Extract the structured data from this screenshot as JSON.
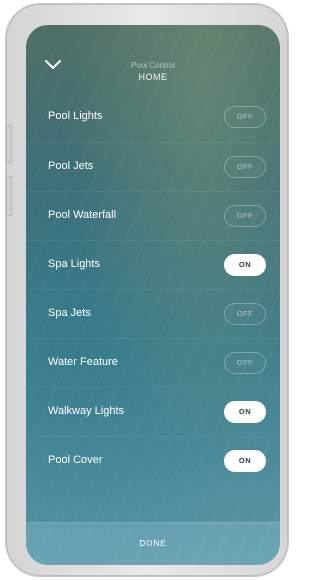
{
  "header": {
    "subtitle": "Pool Control",
    "title": "HOME",
    "back_icon": "chevron-down-icon"
  },
  "items": [
    {
      "label": "Pool Lights",
      "state": "OFF"
    },
    {
      "label": "Pool Jets",
      "state": "OFF"
    },
    {
      "label": "Pool Waterfall",
      "state": "OFF"
    },
    {
      "label": "Spa Lights",
      "state": "ON"
    },
    {
      "label": "Spa Jets",
      "state": "OFF"
    },
    {
      "label": "Water Feature",
      "state": "OFF"
    },
    {
      "label": "Walkway Lights",
      "state": "ON"
    },
    {
      "label": "Pool Cover",
      "state": "ON"
    }
  ],
  "footer": {
    "done_label": "DONE"
  },
  "colors": {
    "toggle_on_bg": "#ffffff",
    "toggle_on_text": "#2e3f46",
    "text": "#ffffff"
  }
}
